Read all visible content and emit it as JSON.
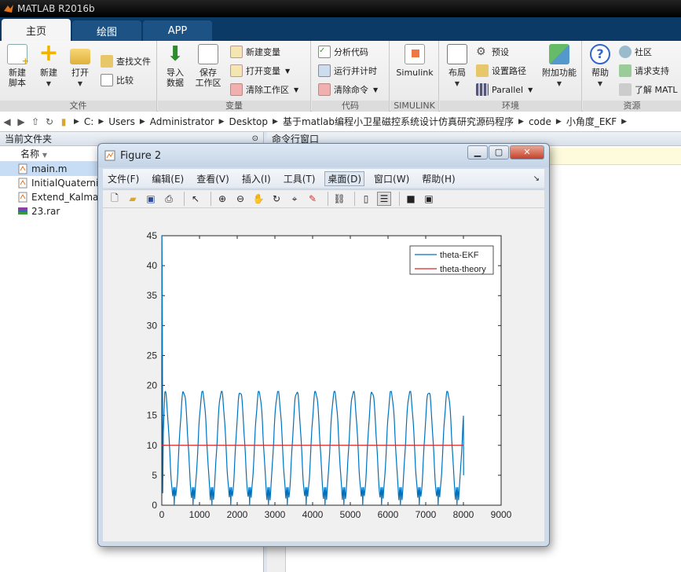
{
  "app": {
    "title": "MATLAB R2016b"
  },
  "tabs": [
    {
      "label": "主页",
      "active": true
    },
    {
      "label": "绘图",
      "active": false
    },
    {
      "label": "APP",
      "active": false
    }
  ],
  "ribbon": {
    "file_group": {
      "label": "文件",
      "new_script": "新建\n脚本",
      "new": "新建",
      "open": "打开",
      "find_files": "查找文件",
      "compare": "比较"
    },
    "var_group": {
      "label": "变量",
      "import": "导入\n数据",
      "save_ws": "保存\n工作区",
      "new_var": "新建变量",
      "open_var": "打开变量",
      "clear_ws": "清除工作区"
    },
    "code_group": {
      "label": "代码",
      "analyze": "分析代码",
      "run_time": "运行并计时",
      "clear_cmd": "清除命令"
    },
    "simulink_group": {
      "label": "SIMULINK",
      "simulink": "Simulink"
    },
    "env_group": {
      "label": "环境",
      "layout": "布局",
      "prefs": "预设",
      "set_path": "设置路径",
      "parallel": "Parallel",
      "addons": "附加功能"
    },
    "resources_group": {
      "label": "资源",
      "help": "帮助",
      "community": "社区",
      "support": "请求支持",
      "learn": "了解 MATL"
    }
  },
  "address": {
    "crumbs": [
      "C:",
      "Users",
      "Administrator",
      "Desktop",
      "基于matlab编程小卫星磁控系统设计仿真研究源码程序",
      "code",
      "小角度_EKF"
    ]
  },
  "folder_panel": {
    "title": "当前文件夹",
    "col_name": "名称",
    "files": [
      {
        "name": "main.m",
        "icon": "m-file-icon",
        "selected": true
      },
      {
        "name": "InitialQuaternio",
        "icon": "m-file-icon",
        "selected": false
      },
      {
        "name": "Extend_Kalman",
        "icon": "m-file-icon",
        "selected": false
      },
      {
        "name": "23.rar",
        "icon": "rar-icon",
        "selected": false
      }
    ]
  },
  "command_panel": {
    "title": "命令行窗口"
  },
  "figure": {
    "title": "Figure 2",
    "menu": [
      "文件(F)",
      "编辑(E)",
      "查看(V)",
      "插入(I)",
      "工具(T)",
      "桌面(D)",
      "窗口(W)",
      "帮助(H)"
    ],
    "active_menu": "桌面(D)",
    "toolbar_icons": [
      "new-figure-icon",
      "open-icon",
      "save-icon",
      "print-icon",
      "pointer-icon",
      "zoom-in-icon",
      "zoom-out-icon",
      "pan-icon",
      "rotate-icon",
      "data-cursor-icon",
      "brush-icon",
      "link-icon",
      "colorbar-icon",
      "legend-icon",
      "hide-plot-tools-icon",
      "show-plot-tools-icon"
    ]
  },
  "chart_data": {
    "type": "line",
    "title": "",
    "xlabel": "",
    "ylabel": "",
    "xlim": [
      0,
      9000
    ],
    "ylim": [
      0,
      45
    ],
    "xticks": [
      0,
      1000,
      2000,
      3000,
      4000,
      5000,
      6000,
      7000,
      8000,
      9000
    ],
    "yticks": [
      0,
      5,
      10,
      15,
      20,
      25,
      30,
      35,
      40,
      45
    ],
    "grid": false,
    "legend_position": "top-right",
    "series": [
      {
        "name": "theta-EKF",
        "color": "#0072bd",
        "description_values": {
          "initial_spike_max": 45,
          "oscillation_min": 0,
          "oscillation_max": 19,
          "period": 500,
          "x_end": 8000,
          "final_value": 5
        }
      },
      {
        "name": "theta-theory",
        "color": "#d62728",
        "x": [
          0,
          8000
        ],
        "y": [
          10,
          10
        ]
      }
    ]
  }
}
